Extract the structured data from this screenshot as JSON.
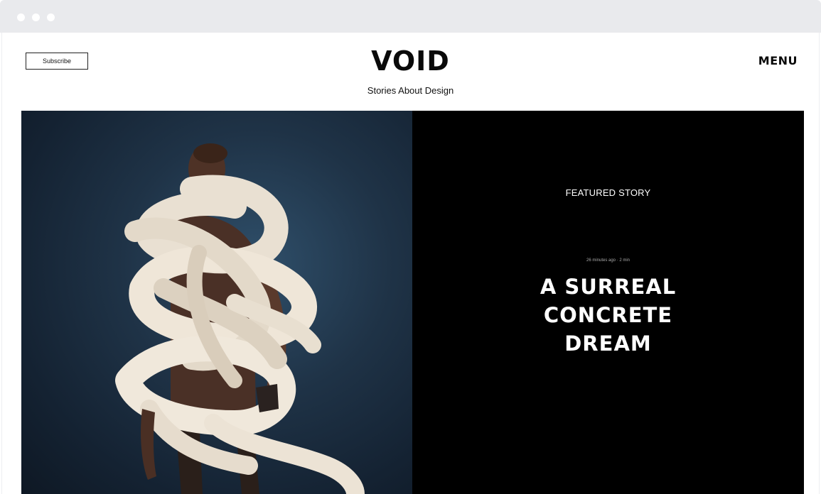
{
  "header": {
    "subscribe_label": "Subscribe",
    "logo": "VOID",
    "tagline": "Stories About Design",
    "menu_label": "MENU"
  },
  "featured": {
    "label": "FEATURED STORY",
    "meta": "26 minutes ago · 2 min",
    "title_lines": [
      "A SURREAL",
      "CONCRETE",
      "DREAM"
    ]
  },
  "colors": {
    "panel_background": "#000000",
    "chrome": "#e9eaed"
  }
}
